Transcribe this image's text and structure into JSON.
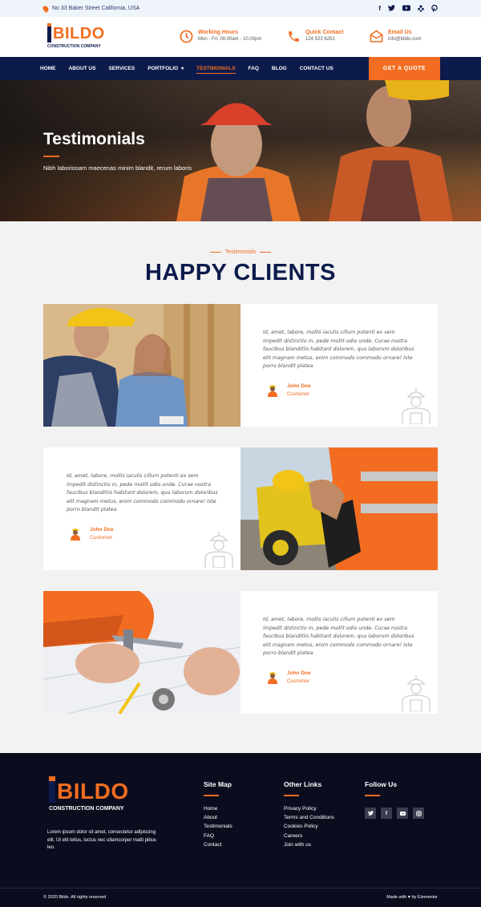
{
  "topbar": {
    "address": "No 33 Baker Street California, USA",
    "socials": [
      "f",
      "t",
      "yt",
      "yelp",
      "p"
    ]
  },
  "header": {
    "logo_text": "BILDO",
    "logo_sub": "CONSTRUCTION COMPANY",
    "working_hours_title": "Working Hours",
    "working_hours_value": "Mon - Fri: 09.00am - 10.00pm",
    "call_title": "Quick Contact",
    "call_value": "124 523 6251",
    "email_title": "Email Us",
    "email_value": "info@bildo.com"
  },
  "nav": {
    "items": [
      "HOME",
      "ABOUT US",
      "SERVICES",
      "PORTFOLIO",
      "TESTIMONIALS",
      "FAQ",
      "BLOG",
      "CONTACT US"
    ],
    "active": "TESTIMONIALS",
    "cta": "GET A QUOTE"
  },
  "hero": {
    "title": "Testimonials",
    "subtitle": "Nibh laboriosam maecenas minim blandit, rerum laboris"
  },
  "section": {
    "tag": "Testimonials",
    "title": "HAPPY CLIENTS"
  },
  "testimonials": [
    {
      "text": "Id, amet, labore, mollis iaculis cillum potenti ex sem impedit distinctio in, pede mollit odio unde. Curae nostra faucibus blanditiis habitant dolorem, quo laborum doloribus elit magnam metus, enim commodo commodo ornare! Iste porro blandit platea",
      "name": "John Doe",
      "role": "Customer"
    },
    {
      "text": "Id, amet, labore, mollis iaculis cillum potenti ex sem impedit distinctio in, pede mollit odio unde. Curae nostra faucibus blanditiis habitant dolorem, quo laborum doloribus elit magnam metus, enim commodo commodo ornare! Iste porro blandit platea",
      "name": "John Doe",
      "role": "Customer"
    },
    {
      "text": "Id, amet, labore, mollis iaculis cillum potenti ex sem impedit distinctio in, pede mollit odio unde. Curae nostra faucibus blanditiis habitant dolorem, quo laborum doloribus elit magnam metus, enim commodo commodo ornare! Iste porro blandit platea",
      "name": "John Doe",
      "role": "Customer"
    }
  ],
  "footer": {
    "logo_text": "BILDO",
    "logo_sub": "CONSTRUCTION COMPANY",
    "description": "Lorem ipsum dolor sit amet, consectetur adipiscing elit. Ut elit tellus, luctus nec ullamcorper matti pibus leo.",
    "sitemap_title": "Site Map",
    "sitemap": [
      "Home",
      "About",
      "Testimonials",
      "FAQ",
      "Contact"
    ],
    "links_title": "Other Links",
    "links": [
      "Privacy Policy",
      "Terms and Conditions",
      "Cookies Policy",
      "Careers",
      "Join with us"
    ],
    "follow_title": "Follow Us",
    "follow": [
      "t",
      "f",
      "yt",
      "ig"
    ],
    "copyright": "© 2020 Bildo. All rights reserved",
    "made_with": "Made with ♥ by Elementor"
  },
  "colors": {
    "accent": "#f26d21",
    "navy": "#0d1b4c",
    "footer_bg": "#0b0d1f"
  }
}
